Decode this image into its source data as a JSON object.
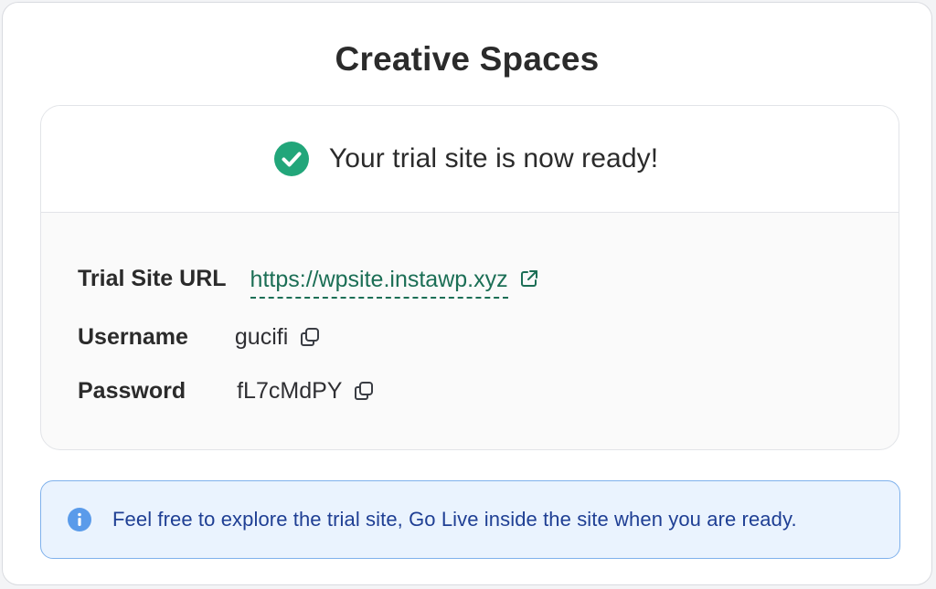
{
  "header": {
    "title": "Creative Spaces"
  },
  "card": {
    "ready_message": "Your trial site is now ready!",
    "status_icon": "check-circle-icon",
    "status_color": "#22a67a",
    "fields": {
      "url_label": "Trial Site URL",
      "url_value": "https://wpsite.instawp.xyz",
      "username_label": "Username",
      "username_value": "gucifi",
      "password_label": "Password",
      "password_value": "fL7cMdPY"
    },
    "link_color": "#1b6e55"
  },
  "notice": {
    "icon": "info-icon",
    "text": "Feel free to explore the trial site, Go Live inside the site when you are ready.",
    "accent_color": "#5a9bea"
  }
}
